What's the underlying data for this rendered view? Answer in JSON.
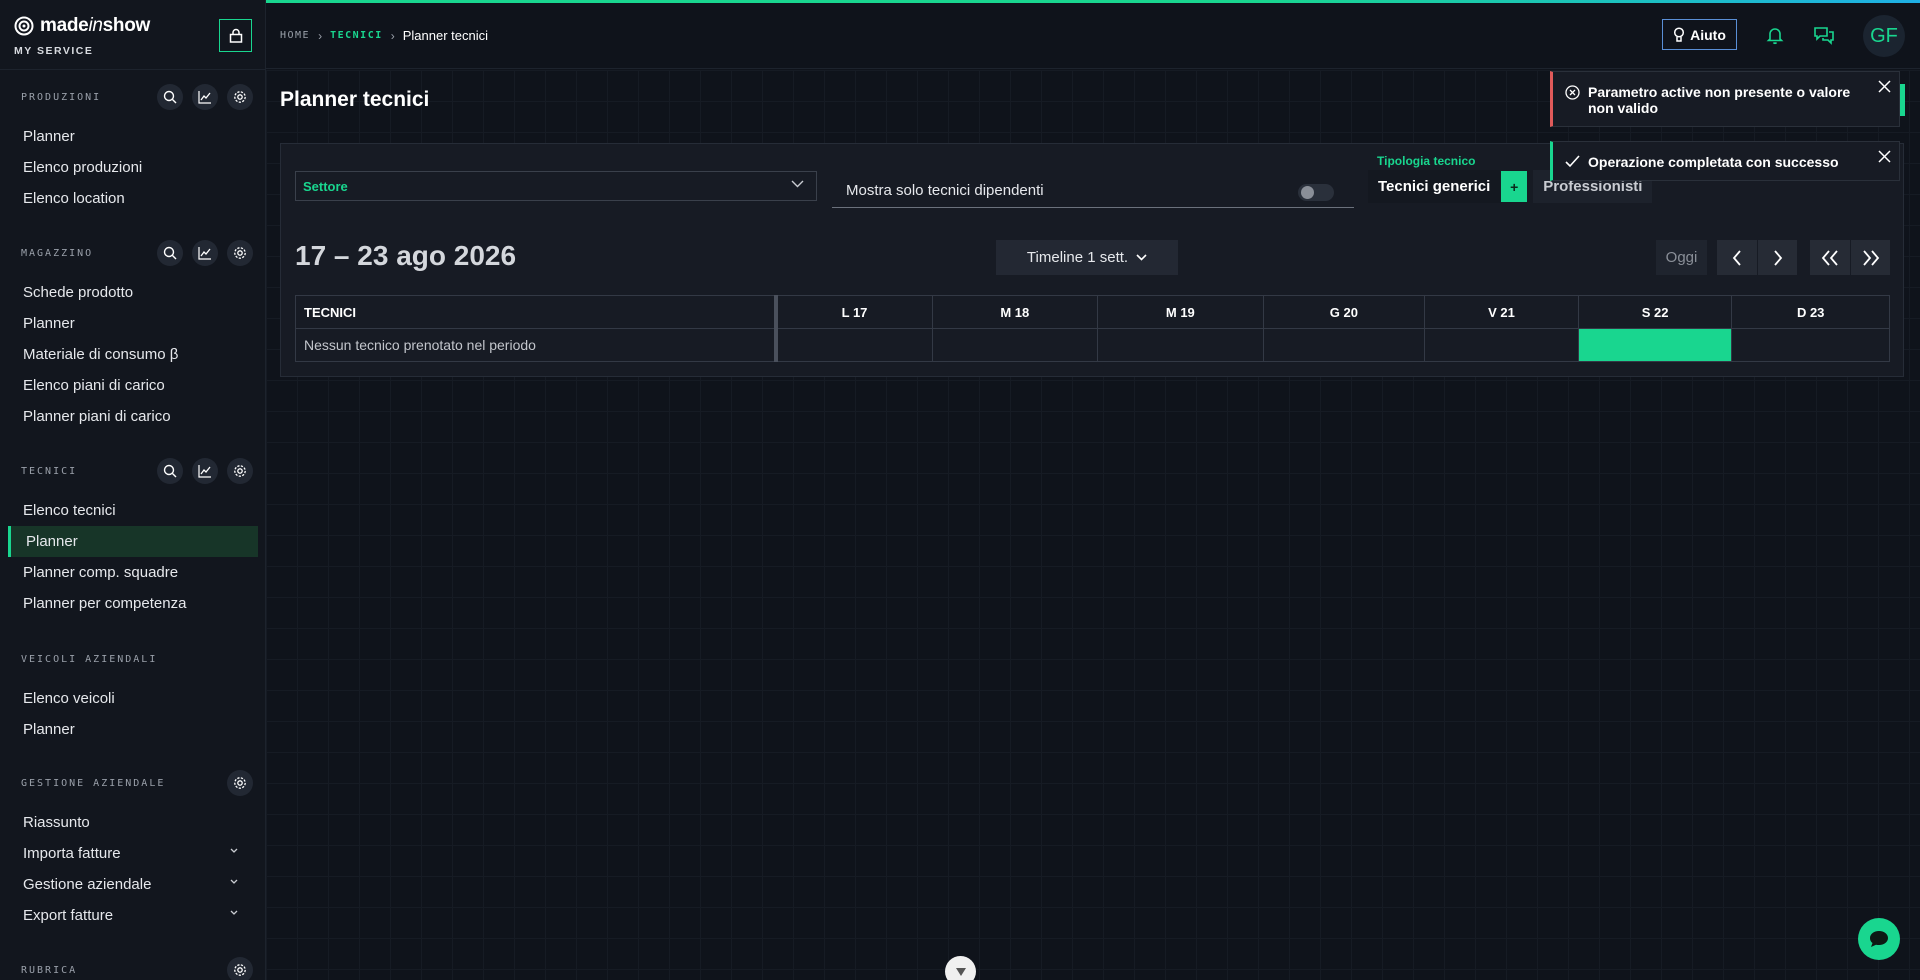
{
  "brand": {
    "name_a": "made",
    "name_b": "in",
    "name_c": "show",
    "sub": "MY SERVICE"
  },
  "sidebar": {
    "sections": [
      {
        "title": "PRODUZIONI",
        "items": [
          "Planner",
          "Elenco produzioni",
          "Elenco location"
        ]
      },
      {
        "title": "MAGAZZINO",
        "items": [
          "Schede prodotto",
          "Planner",
          "Materiale di consumo β",
          "Elenco piani di carico",
          "Planner piani di carico"
        ]
      },
      {
        "title": "TECNICI",
        "items": [
          "Elenco tecnici",
          "Planner",
          "Planner comp. squadre",
          "Planner per competenza"
        ],
        "active": "Planner"
      },
      {
        "title": "VEICOLI AZIENDALI",
        "items": [
          "Elenco veicoli",
          "Planner"
        ]
      },
      {
        "title": "GESTIONE AZIENDALE",
        "items": [
          "Riassunto",
          "Importa fatture",
          "Gestione aziendale",
          "Export fatture"
        ]
      },
      {
        "title": "RUBRICA",
        "items": []
      }
    ],
    "s0": {
      "title": "PRODUZIONI",
      "i0": "Planner",
      "i1": "Elenco produzioni",
      "i2": "Elenco location"
    },
    "s1": {
      "title": "MAGAZZINO",
      "i0": "Schede prodotto",
      "i1": "Planner",
      "i2": "Materiale di consumo β",
      "i3": "Elenco piani di carico",
      "i4": "Planner piani di carico"
    },
    "s2": {
      "title": "TECNICI",
      "i0": "Elenco tecnici",
      "i1": "Planner",
      "i2": "Planner comp. squadre",
      "i3": "Planner per competenza"
    },
    "s3": {
      "title": "VEICOLI AZIENDALI",
      "i0": "Elenco veicoli",
      "i1": "Planner"
    },
    "s4": {
      "title": "GESTIONE AZIENDALE",
      "i0": "Riassunto",
      "i1": "Importa fatture",
      "i2": "Gestione aziendale",
      "i3": "Export fatture"
    },
    "s5": {
      "title": "RUBRICA"
    }
  },
  "breadcrumb": {
    "home": "HOME",
    "section": "TECNICI",
    "current": "Planner tecnici"
  },
  "header": {
    "help_label": "Aiuto",
    "avatar_initials": "GF"
  },
  "page": {
    "title": "Planner tecnici"
  },
  "filters": {
    "settore_label": "Settore",
    "toggle_label": "Mostra solo tecnici dipendenti",
    "tipologia_label": "Tipologia tecnico",
    "tipologia_a": "Tecnici generici",
    "tipologia_plus": "+",
    "tipologia_b": "Professionisti"
  },
  "planner": {
    "range": "17 – 23 ago 2026",
    "timeline_label": "Timeline 1 sett.",
    "today_label": "Oggi",
    "col_head": "TECNICI",
    "days": [
      "L 17",
      "M 18",
      "M 19",
      "G 20",
      "V 21",
      "S 22",
      "D 23"
    ],
    "d0": "L 17",
    "d1": "M 18",
    "d2": "M 19",
    "d3": "G 20",
    "d4": "V 21",
    "d5": "S 22",
    "d6": "D 23",
    "highlighted_day": "S 22",
    "empty_message": "Nessun tecnico prenotato nel periodo"
  },
  "toasts": {
    "error": "Parametro active non presente o valore non valido",
    "success": "Operazione completata con successo"
  },
  "colors": {
    "accent": "#19d68f",
    "error": "#e05a5a",
    "background": "#0f131b",
    "help_border": "#5a8fd6"
  }
}
